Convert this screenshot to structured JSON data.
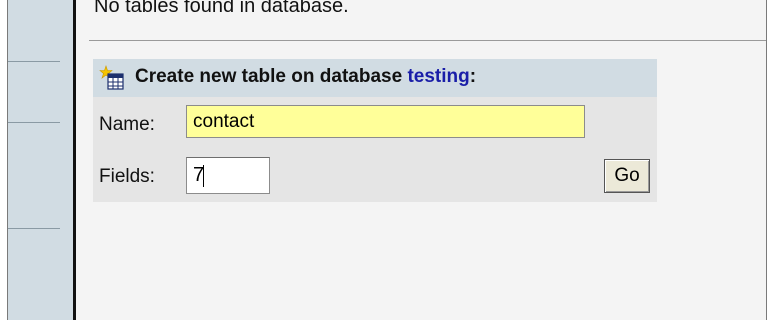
{
  "notice": "No tables found in database.",
  "create_table": {
    "header_prefix": "Create new table on database",
    "database_name": "testing",
    "header_suffix": ":",
    "icon": "new-table-icon",
    "name_label": "Name:",
    "name_value": "contact",
    "fields_label": "Fields:",
    "fields_value": "7",
    "go_label": "Go"
  },
  "colors": {
    "sidebar": "#d1dce3",
    "panel": "#e5e5e5",
    "name_field_bg": "#ffff99",
    "db_link": "#1a1ea8"
  }
}
